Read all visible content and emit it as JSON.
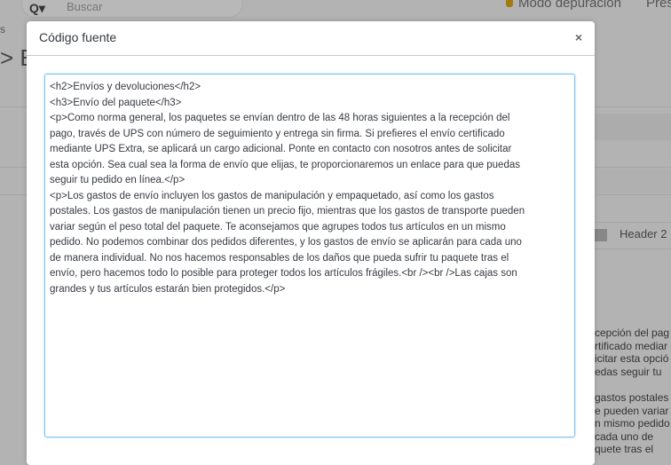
{
  "background": {
    "search_placeholder": "Buscar",
    "debug_mode": "Modo depuración",
    "preview_partial": "Pres",
    "breadcrumb_partial": "s",
    "title_partial": "> E",
    "header2_label": "Header 2",
    "fragments": [
      [
        "cepción del pag",
        "rtificado mediar",
        "icitar esta opció",
        "edas seguir tu"
      ],
      [
        "gastos postales",
        "e pueden variar",
        "n mismo pedido",
        "cada uno de",
        "quete tras el"
      ]
    ]
  },
  "modal": {
    "title": "Código fuente",
    "close_label": "×",
    "source_lines": [
      "<h2>Envíos y devoluciones</h2>",
      "<h3>Envío del paquete</h3>",
      "<p>Como norma general, los paquetes se envían dentro de las 48 horas siguientes a la recepción del",
      "pago, través de UPS con número de seguimiento y entrega sin firma. Si prefieres el envío certificado",
      "mediante UPS Extra, se aplicará un cargo adicional. Ponte en contacto con nosotros antes de solicitar",
      "esta opción. Sea cual sea la forma de envío que elijas, te proporcionaremos un enlace para que puedas",
      "seguir tu pedido en línea.</p>",
      "<p>Los gastos de envío incluyen los gastos de manipulación y empaquetado, así como los gastos",
      "postales. Los gastos de manipulación tienen un precio fijo, mientras que los gastos de transporte pueden",
      "variar según el peso total del paquete. Te aconsejamos que agrupes todos tus artículos en un mismo",
      "pedido. No podemos combinar dos pedidos diferentes, y los gastos de envío se aplicarán para cada uno",
      "de manera individual. No nos hacemos responsables de los daños que pueda sufrir tu paquete tras el",
      "envío, pero hacemos todo lo posible para proteger todos los artículos frágiles.<br /><br />Las cajas son",
      "grandes y tus artículos estarán bien protegidos.</p>"
    ]
  }
}
